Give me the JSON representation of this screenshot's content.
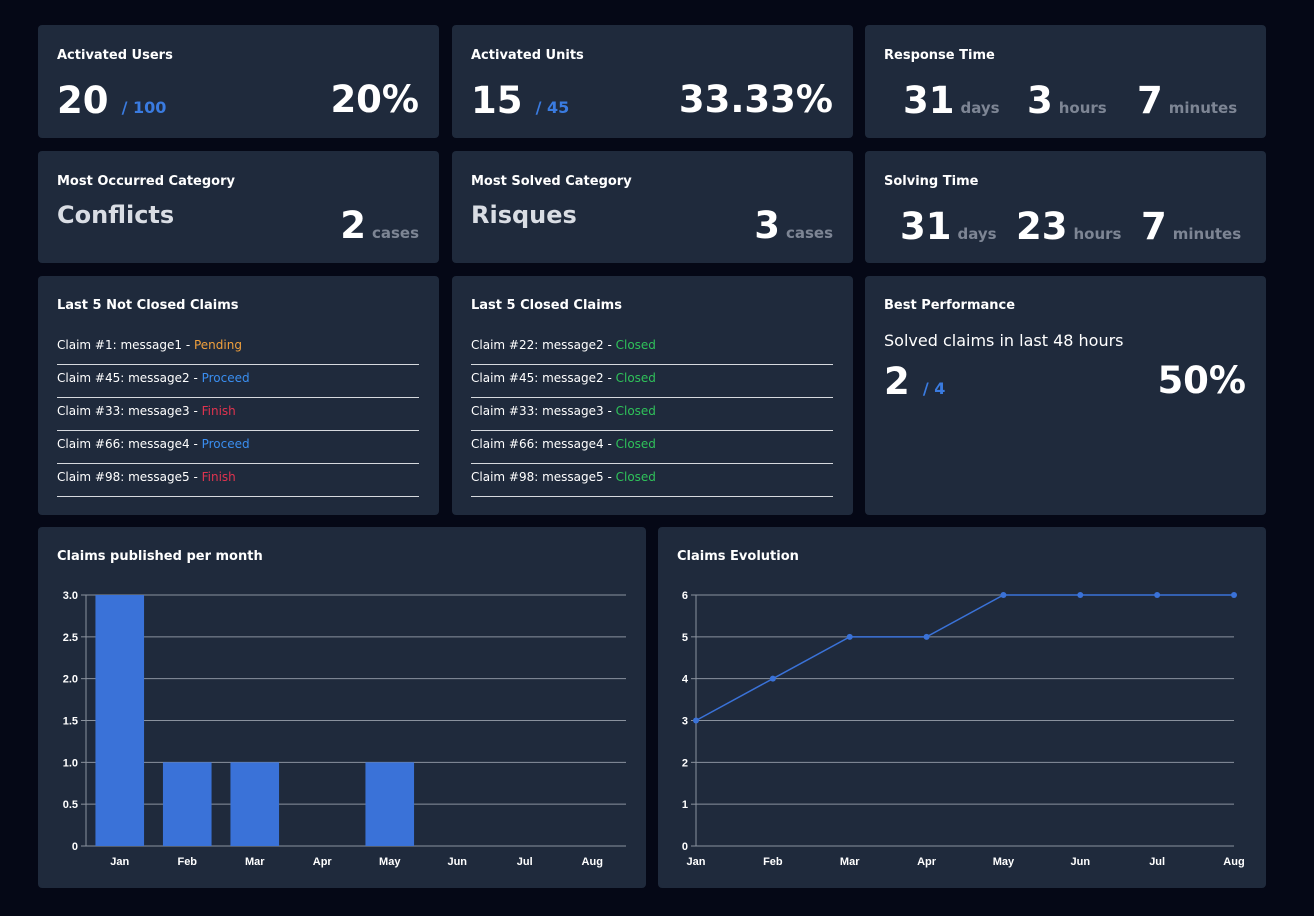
{
  "activated_users": {
    "title": "Activated Users",
    "value": "20",
    "total": "/ 100",
    "percent": "20%"
  },
  "activated_units": {
    "title": "Activated Units",
    "value": "15",
    "total": "/ 45",
    "percent": "33.33%"
  },
  "response_time": {
    "title": "Response Time",
    "days": "31",
    "days_label": "days",
    "hours": "3",
    "hours_label": "hours",
    "minutes": "7",
    "minutes_label": "minutes"
  },
  "most_occurred": {
    "title": "Most Occurred Category",
    "category": "Conflicts",
    "count": "2",
    "unit": "cases"
  },
  "most_solved": {
    "title": "Most Solved Category",
    "category": "Risques",
    "count": "3",
    "unit": "cases"
  },
  "solving_time": {
    "title": "Solving Time",
    "days": "31",
    "days_label": "days",
    "hours": "23",
    "hours_label": "hours",
    "minutes": "7",
    "minutes_label": "minutes"
  },
  "not_closed": {
    "title": "Last 5 Not Closed Claims",
    "items": [
      {
        "text": "Claim #1: message1 - ",
        "status": "Pending",
        "status_color": "#f0a03c"
      },
      {
        "text": "Claim #45: message2 - ",
        "status": "Proceed",
        "status_color": "#3a8ef0"
      },
      {
        "text": "Claim #33: message3 - ",
        "status": "Finish",
        "status_color": "#e0334f"
      },
      {
        "text": "Claim #66: message4 - ",
        "status": "Proceed",
        "status_color": "#3a8ef0"
      },
      {
        "text": "Claim #98: message5 - ",
        "status": "Finish",
        "status_color": "#e0334f"
      }
    ]
  },
  "closed": {
    "title": "Last 5 Closed Claims",
    "items": [
      {
        "text": "Claim #22: message2 - ",
        "status": "Closed",
        "status_color": "#2fc15a"
      },
      {
        "text": "Claim #45: message2 - ",
        "status": "Closed",
        "status_color": "#2fc15a"
      },
      {
        "text": "Claim #33: message3 - ",
        "status": "Closed",
        "status_color": "#2fc15a"
      },
      {
        "text": "Claim #66: message4 - ",
        "status": "Closed",
        "status_color": "#2fc15a"
      },
      {
        "text": "Claim #98: message5 - ",
        "status": "Closed",
        "status_color": "#2fc15a"
      }
    ]
  },
  "best_performance": {
    "title": "Best Performance",
    "subtitle": "Solved claims in last 48 hours",
    "value": "2",
    "total": "/ 4",
    "percent": "50%"
  },
  "colors": {
    "background": "#050816",
    "card": "#1f2a3c",
    "accent": "#3a7be0",
    "muted": "#7d8594"
  },
  "chart_data": [
    {
      "type": "bar",
      "title": "Claims published per month",
      "categories": [
        "Jan",
        "Feb",
        "Mar",
        "Apr",
        "May",
        "Jun",
        "Jul",
        "Aug"
      ],
      "values": [
        3,
        1,
        1,
        0,
        1,
        0,
        0,
        0
      ],
      "ylim": [
        0,
        3
      ],
      "yticks": [
        "0",
        "0.5",
        "1.0",
        "1.5",
        "2.0",
        "2.5",
        "3.0"
      ],
      "grid": true,
      "color": "#3a72d8"
    },
    {
      "type": "line",
      "title": "Claims Evolution",
      "categories": [
        "Jan",
        "Feb",
        "Mar",
        "Apr",
        "May",
        "Jun",
        "Jul",
        "Aug"
      ],
      "values": [
        3,
        4,
        5,
        5,
        6,
        6,
        6,
        6
      ],
      "ylim": [
        0,
        6
      ],
      "yticks": [
        "0",
        "1",
        "2",
        "3",
        "4",
        "5",
        "6"
      ],
      "grid": true,
      "color": "#3a72d8"
    }
  ]
}
